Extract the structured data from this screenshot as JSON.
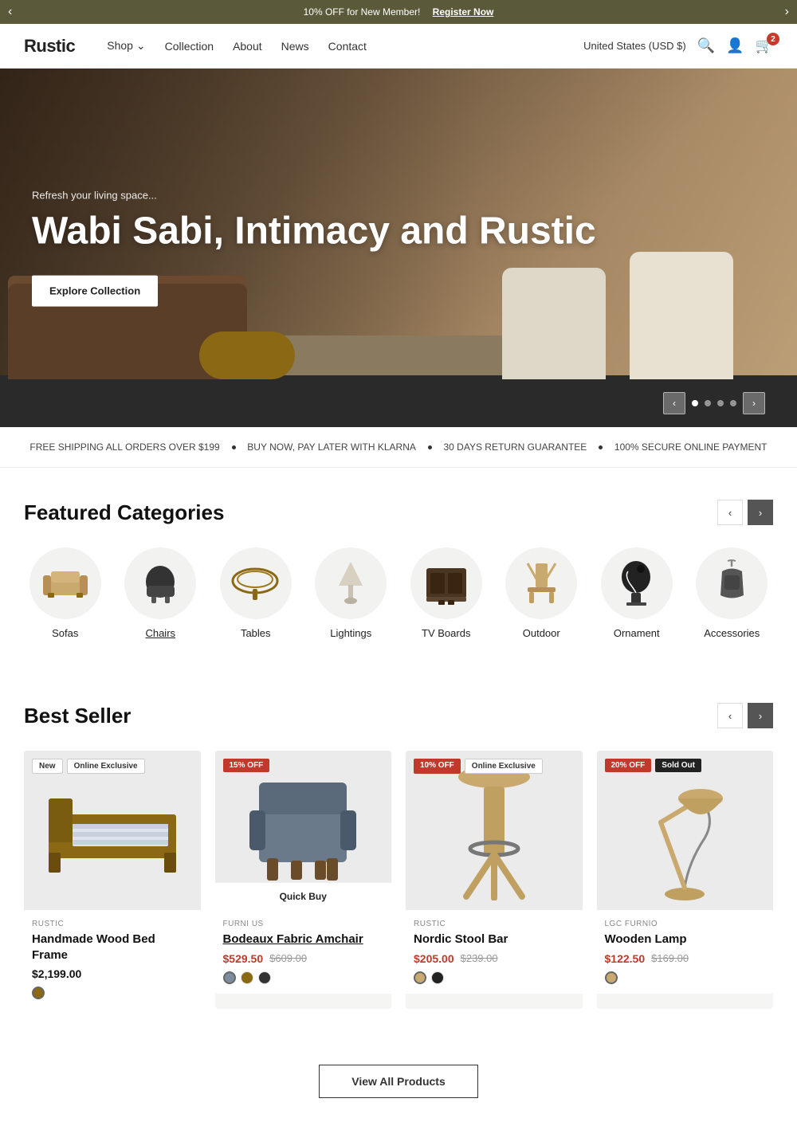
{
  "announcement": {
    "text": "10% OFF for New Member!",
    "link_text": "Register Now"
  },
  "header": {
    "logo": "Rustic",
    "nav": [
      {
        "label": "Shop",
        "has_dropdown": true
      },
      {
        "label": "Collection"
      },
      {
        "label": "About"
      },
      {
        "label": "News"
      },
      {
        "label": "Contact"
      }
    ],
    "country": "United States (USD $)",
    "cart_count": "2"
  },
  "hero": {
    "subtitle": "Refresh your living space...",
    "title": "Wabi Sabi, Intimacy and Rustic",
    "cta": "Explore Collection",
    "dots": 4,
    "active_dot": 0
  },
  "perks": [
    "FREE SHIPPING ALL ORDERS OVER $199",
    "BUY NOW, PAY LATER WITH KLARNA",
    "30 DAYS RETURN GUARANTEE",
    "100% SECURE ONLINE PAYMENT"
  ],
  "featured_categories": {
    "title": "Featured Categories",
    "items": [
      {
        "label": "Sofas",
        "underlined": false
      },
      {
        "label": "Chairs",
        "underlined": true
      },
      {
        "label": "Tables",
        "underlined": false
      },
      {
        "label": "Lightings",
        "underlined": false
      },
      {
        "label": "TV Boards",
        "underlined": false
      },
      {
        "label": "Outdoor",
        "underlined": false
      },
      {
        "label": "Ornament",
        "underlined": false
      },
      {
        "label": "Accessories",
        "underlined": false
      }
    ]
  },
  "best_seller": {
    "title": "Best Seller",
    "products": [
      {
        "badges": [
          {
            "text": "New",
            "type": "new"
          },
          {
            "text": "Online Exclusive",
            "type": "exclusive"
          }
        ],
        "brand": "RUSTIC",
        "name": "Handmade Wood Bed Frame",
        "price_current": "$2,199.00",
        "price_original": null,
        "swatches": [
          "#8B6914"
        ],
        "type": "bed"
      },
      {
        "badges": [
          {
            "text": "15% OFF",
            "type": "sale"
          }
        ],
        "brand": "FURNI US",
        "name": "Bodeaux Fabric Amchair",
        "price_current": "$529.50",
        "price_original": "$609.00",
        "swatches": [
          "#7a8c9e",
          "#8B6914",
          "#333"
        ],
        "type": "chair",
        "show_quickbuy": true
      },
      {
        "badges": [
          {
            "text": "10% OFF",
            "type": "sale"
          },
          {
            "text": "Online Exclusive",
            "type": "exclusive"
          }
        ],
        "brand": "RUSTIC",
        "name": "Nordic Stool Bar",
        "price_current": "$205.00",
        "price_original": "$239.00",
        "swatches": [
          "#c9a96e",
          "#222"
        ],
        "type": "stool"
      },
      {
        "badges": [
          {
            "text": "20% OFF",
            "type": "sale"
          },
          {
            "text": "Sold Out",
            "type": "soldout"
          }
        ],
        "brand": "LGC FURNIO",
        "name": "Wooden Lamp",
        "price_current": "$122.50",
        "price_original": "$169.00",
        "swatches": [
          "#c9a96e"
        ],
        "type": "lamp"
      }
    ]
  },
  "view_all": "View All Products",
  "quick_buy_label": "Quick Buy"
}
